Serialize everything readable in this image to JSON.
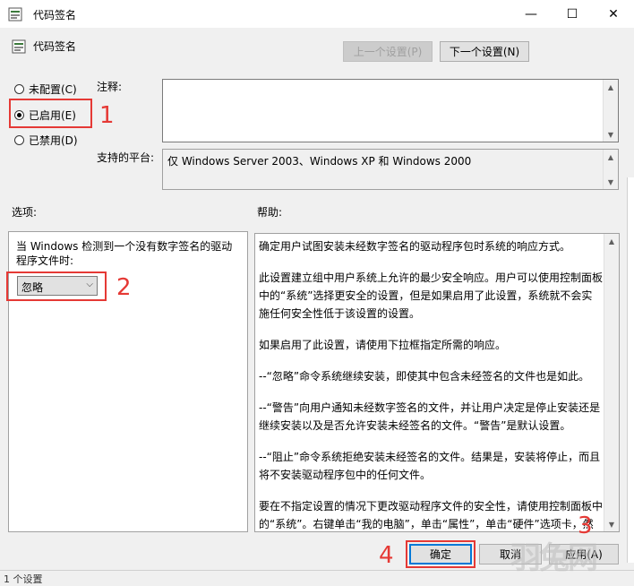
{
  "window": {
    "title": "代码签名",
    "header_title": "代码签名",
    "minimize": "—",
    "maximize": "☐",
    "close": "✕"
  },
  "nav": {
    "prev_setting": "上一个设置(P)",
    "next_setting": "下一个设置(N)"
  },
  "state": {
    "options": [
      {
        "label": "未配置(C)",
        "checked": false
      },
      {
        "label": "已启用(E)",
        "checked": true
      },
      {
        "label": "已禁用(D)",
        "checked": false
      }
    ]
  },
  "comment": {
    "label": "注释:",
    "value": ""
  },
  "platform": {
    "label": "支持的平台:",
    "value": "仅 Windows Server 2003、Windows XP 和 Windows 2000"
  },
  "options": {
    "label": "选项:",
    "description": "当 Windows 检测到一个没有数字签名的驱动程序文件时:",
    "dropdown_value": "忽略"
  },
  "help": {
    "label": "帮助:",
    "paragraphs": [
      "确定用户试图安装未经数字签名的驱动程序包时系统的响应方式。",
      "此设置建立组中用户系统上允许的最少安全响应。用户可以使用控制面板中的“系统”选择更安全的设置，但是如果启用了此设置，系统就不会实施任何安全性低于该设置的设置。",
      "如果启用了此设置，请使用下拉框指定所需的响应。",
      "--“忽略”命令系统继续安装，即使其中包含未经签名的文件也是如此。",
      "--“警告”向用户通知未经数字签名的文件，并让用户决定是停止安装还是继续安装以及是否允许安装未经签名的文件。“警告”是默认设置。",
      "--“阻止”命令系统拒绝安装未经签名的文件。结果是，安装将停止，而且将不安装驱动程序包中的任何文件。",
      "要在不指定设置的情况下更改驱动程序文件的安全性，请使用控制面板中的“系统”。右键单击“我的电脑”，单击“属性”，单击“硬件”选项卡，然后单击“驱动程序签名”按钮。"
    ]
  },
  "buttons": {
    "ok": "确定",
    "cancel": "取消",
    "apply": "应用(A)"
  },
  "annotations": {
    "n1": "1",
    "n2": "2",
    "n3": "3",
    "n4": "4",
    "color": "#e53935"
  },
  "status": {
    "text": "1 个设置"
  },
  "watermark": "羽兔网"
}
